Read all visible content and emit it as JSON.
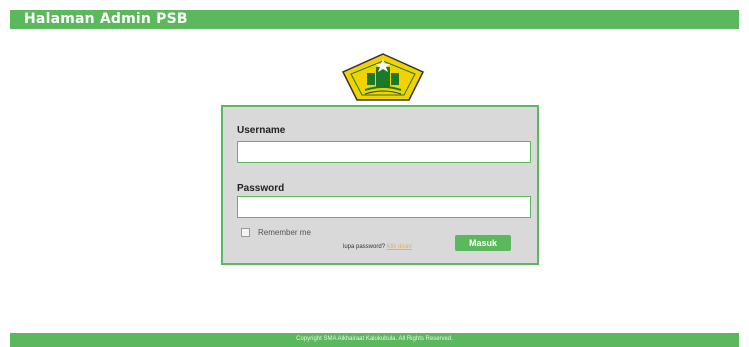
{
  "header": {
    "title": "Halaman Admin PSB"
  },
  "logo": {
    "icon": "school-emblem-icon",
    "colors": {
      "gold": "#f2d200",
      "green": "#1a7a2a",
      "outline": "#333333"
    }
  },
  "login": {
    "username_label": "Username",
    "username_value": "",
    "password_label": "Password",
    "password_value": "",
    "remember_label": "Remember me",
    "forgot_text": "lupa password?",
    "forgot_link": "Klik disini",
    "submit_label": "Masuk"
  },
  "footer": {
    "copyright": "Copyright SMA Alkhairaat Kalukubula. All Rights Reserved."
  },
  "colors": {
    "accent": "#5cb85c",
    "link": "#f0ad4e",
    "box_bg": "#d9d9d9"
  }
}
